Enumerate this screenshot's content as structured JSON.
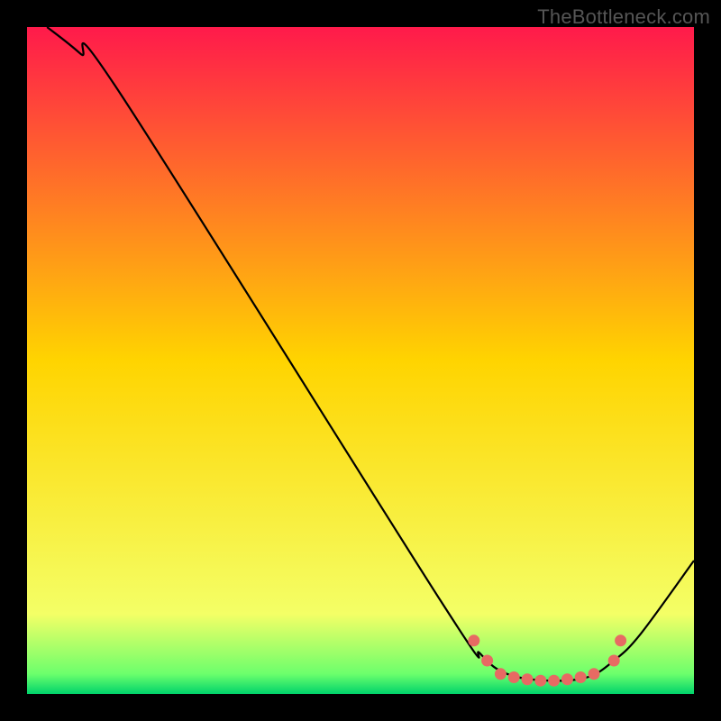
{
  "watermark": "TheBottleneck.com",
  "chart_data": {
    "type": "line",
    "title": "",
    "xlabel": "",
    "ylabel": "",
    "xlim": [
      0,
      100
    ],
    "ylim": [
      0,
      100
    ],
    "grid": false,
    "legend": false,
    "gradient_stops": [
      {
        "offset": 0,
        "color": "#ff1a4b"
      },
      {
        "offset": 50,
        "color": "#ffd400"
      },
      {
        "offset": 88,
        "color": "#f4ff66"
      },
      {
        "offset": 97,
        "color": "#6cff6c"
      },
      {
        "offset": 100,
        "color": "#00d36b"
      }
    ],
    "curve_points": [
      {
        "x": 3,
        "y": 100
      },
      {
        "x": 8,
        "y": 96
      },
      {
        "x": 14,
        "y": 90
      },
      {
        "x": 62,
        "y": 14
      },
      {
        "x": 68,
        "y": 6
      },
      {
        "x": 72,
        "y": 3
      },
      {
        "x": 78,
        "y": 2
      },
      {
        "x": 84,
        "y": 2.5
      },
      {
        "x": 88,
        "y": 5
      },
      {
        "x": 92,
        "y": 9
      },
      {
        "x": 100,
        "y": 20
      }
    ],
    "dots": [
      {
        "x": 67,
        "y": 8
      },
      {
        "x": 69,
        "y": 5
      },
      {
        "x": 71,
        "y": 3
      },
      {
        "x": 73,
        "y": 2.5
      },
      {
        "x": 75,
        "y": 2.2
      },
      {
        "x": 77,
        "y": 2
      },
      {
        "x": 79,
        "y": 2
      },
      {
        "x": 81,
        "y": 2.2
      },
      {
        "x": 83,
        "y": 2.5
      },
      {
        "x": 85,
        "y": 3
      },
      {
        "x": 88,
        "y": 5
      },
      {
        "x": 89,
        "y": 8
      }
    ],
    "dot_radius": 6.5
  }
}
